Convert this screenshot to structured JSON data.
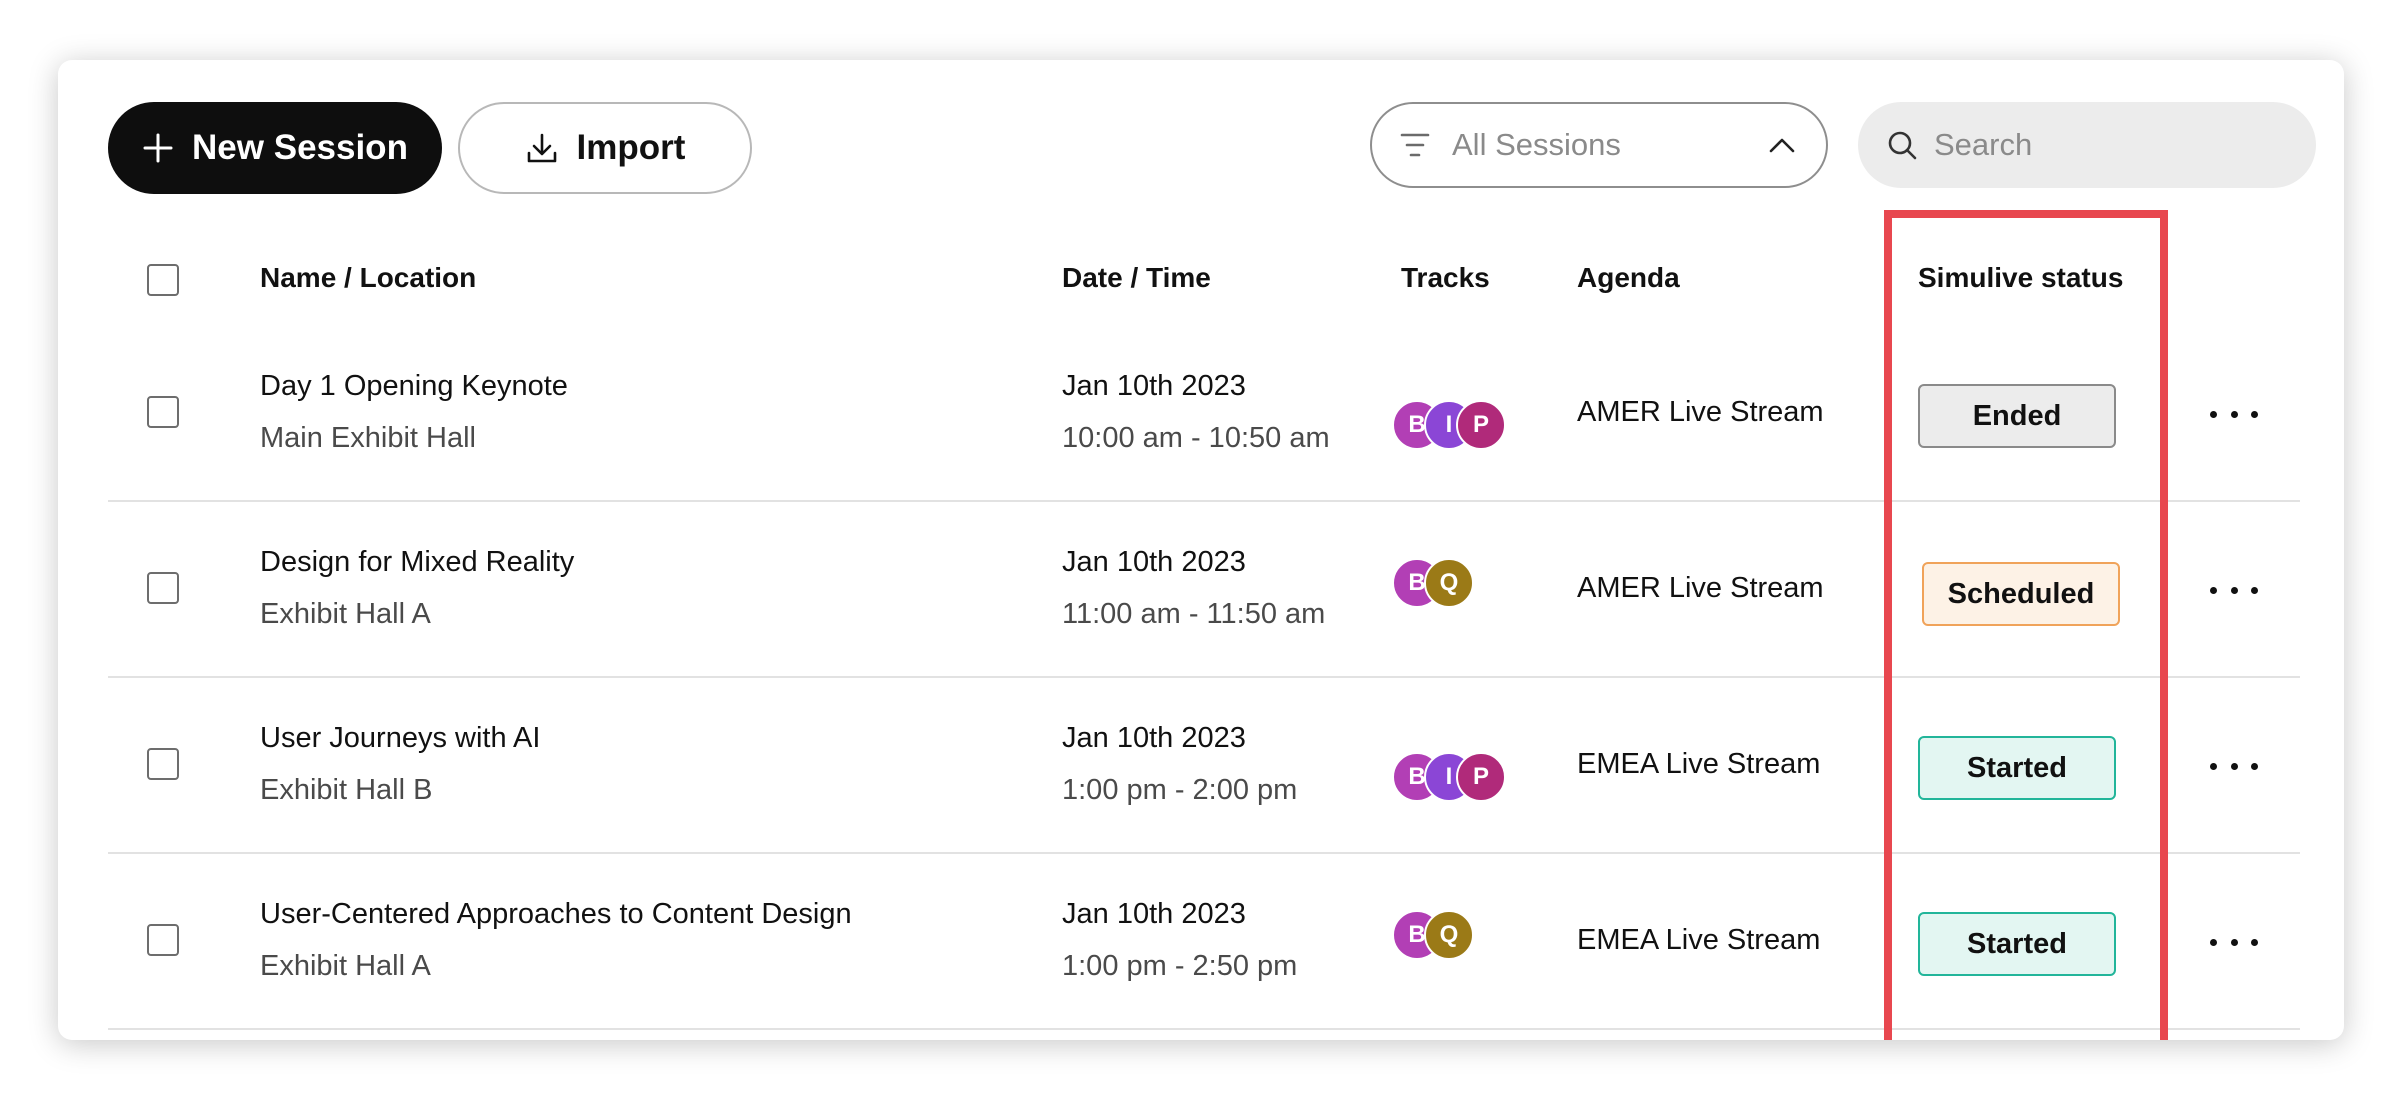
{
  "toolbar": {
    "new_session_label": "New Session",
    "import_label": "Import",
    "filter_value": "All Sessions",
    "search_placeholder": "Search"
  },
  "table": {
    "headers": {
      "name": "Name / Location",
      "date": "Date / Time",
      "tracks": "Tracks",
      "agenda": "Agenda",
      "status": "Simulive status"
    },
    "rows": [
      {
        "name": "Day 1 Opening Keynote",
        "location": "Main Exhibit Hall",
        "date": "Jan 10th 2023",
        "time": "10:00 am - 10:50 am",
        "tracks": [
          {
            "letter": "B",
            "color": "#b23fb5"
          },
          {
            "letter": "I",
            "color": "#8b46d6"
          },
          {
            "letter": "P",
            "color": "#b02a7a"
          }
        ],
        "agenda": "AMER Live Stream",
        "status": "Ended",
        "status_style": {
          "bg": "#ececec",
          "border": "#8a8a8a"
        }
      },
      {
        "name": "Design for Mixed Reality",
        "location": "Exhibit Hall A",
        "date": "Jan 10th 2023",
        "time": "11:00 am - 11:50 am",
        "tracks": [
          {
            "letter": "B",
            "color": "#b23fb5"
          },
          {
            "letter": "Q",
            "color": "#9b7a17"
          }
        ],
        "agenda": "AMER Live Stream",
        "status": "Scheduled",
        "status_style": {
          "bg": "#fdf2e6",
          "border": "#f0a35a"
        }
      },
      {
        "name": "User Journeys with AI",
        "location": "Exhibit Hall B",
        "date": "Jan 10th 2023",
        "time": "1:00 pm - 2:00 pm",
        "tracks": [
          {
            "letter": "B",
            "color": "#b23fb5"
          },
          {
            "letter": "I",
            "color": "#8b46d6"
          },
          {
            "letter": "P",
            "color": "#b02a7a"
          }
        ],
        "agenda": "EMEA Live Stream",
        "status": "Started",
        "status_style": {
          "bg": "#e3f6f2",
          "border": "#22b59a"
        }
      },
      {
        "name": "User-Centered Approaches to Content Design",
        "location": "Exhibit Hall A",
        "date": "Jan 10th 2023",
        "time": "1:00 pm - 2:50 pm",
        "tracks": [
          {
            "letter": "B",
            "color": "#b23fb5"
          },
          {
            "letter": "Q",
            "color": "#9b7a17"
          }
        ],
        "agenda": "EMEA Live Stream",
        "status": "Started",
        "status_style": {
          "bg": "#e3f6f2",
          "border": "#22b59a"
        }
      }
    ]
  },
  "icons": {
    "plus": "plus-icon",
    "download": "download-icon",
    "filter": "filter-lines-icon",
    "chevron": "chevron-up-icon",
    "search": "search-icon",
    "more": "more-horizontal-icon"
  },
  "colors": {
    "highlight": "#e8474f"
  }
}
